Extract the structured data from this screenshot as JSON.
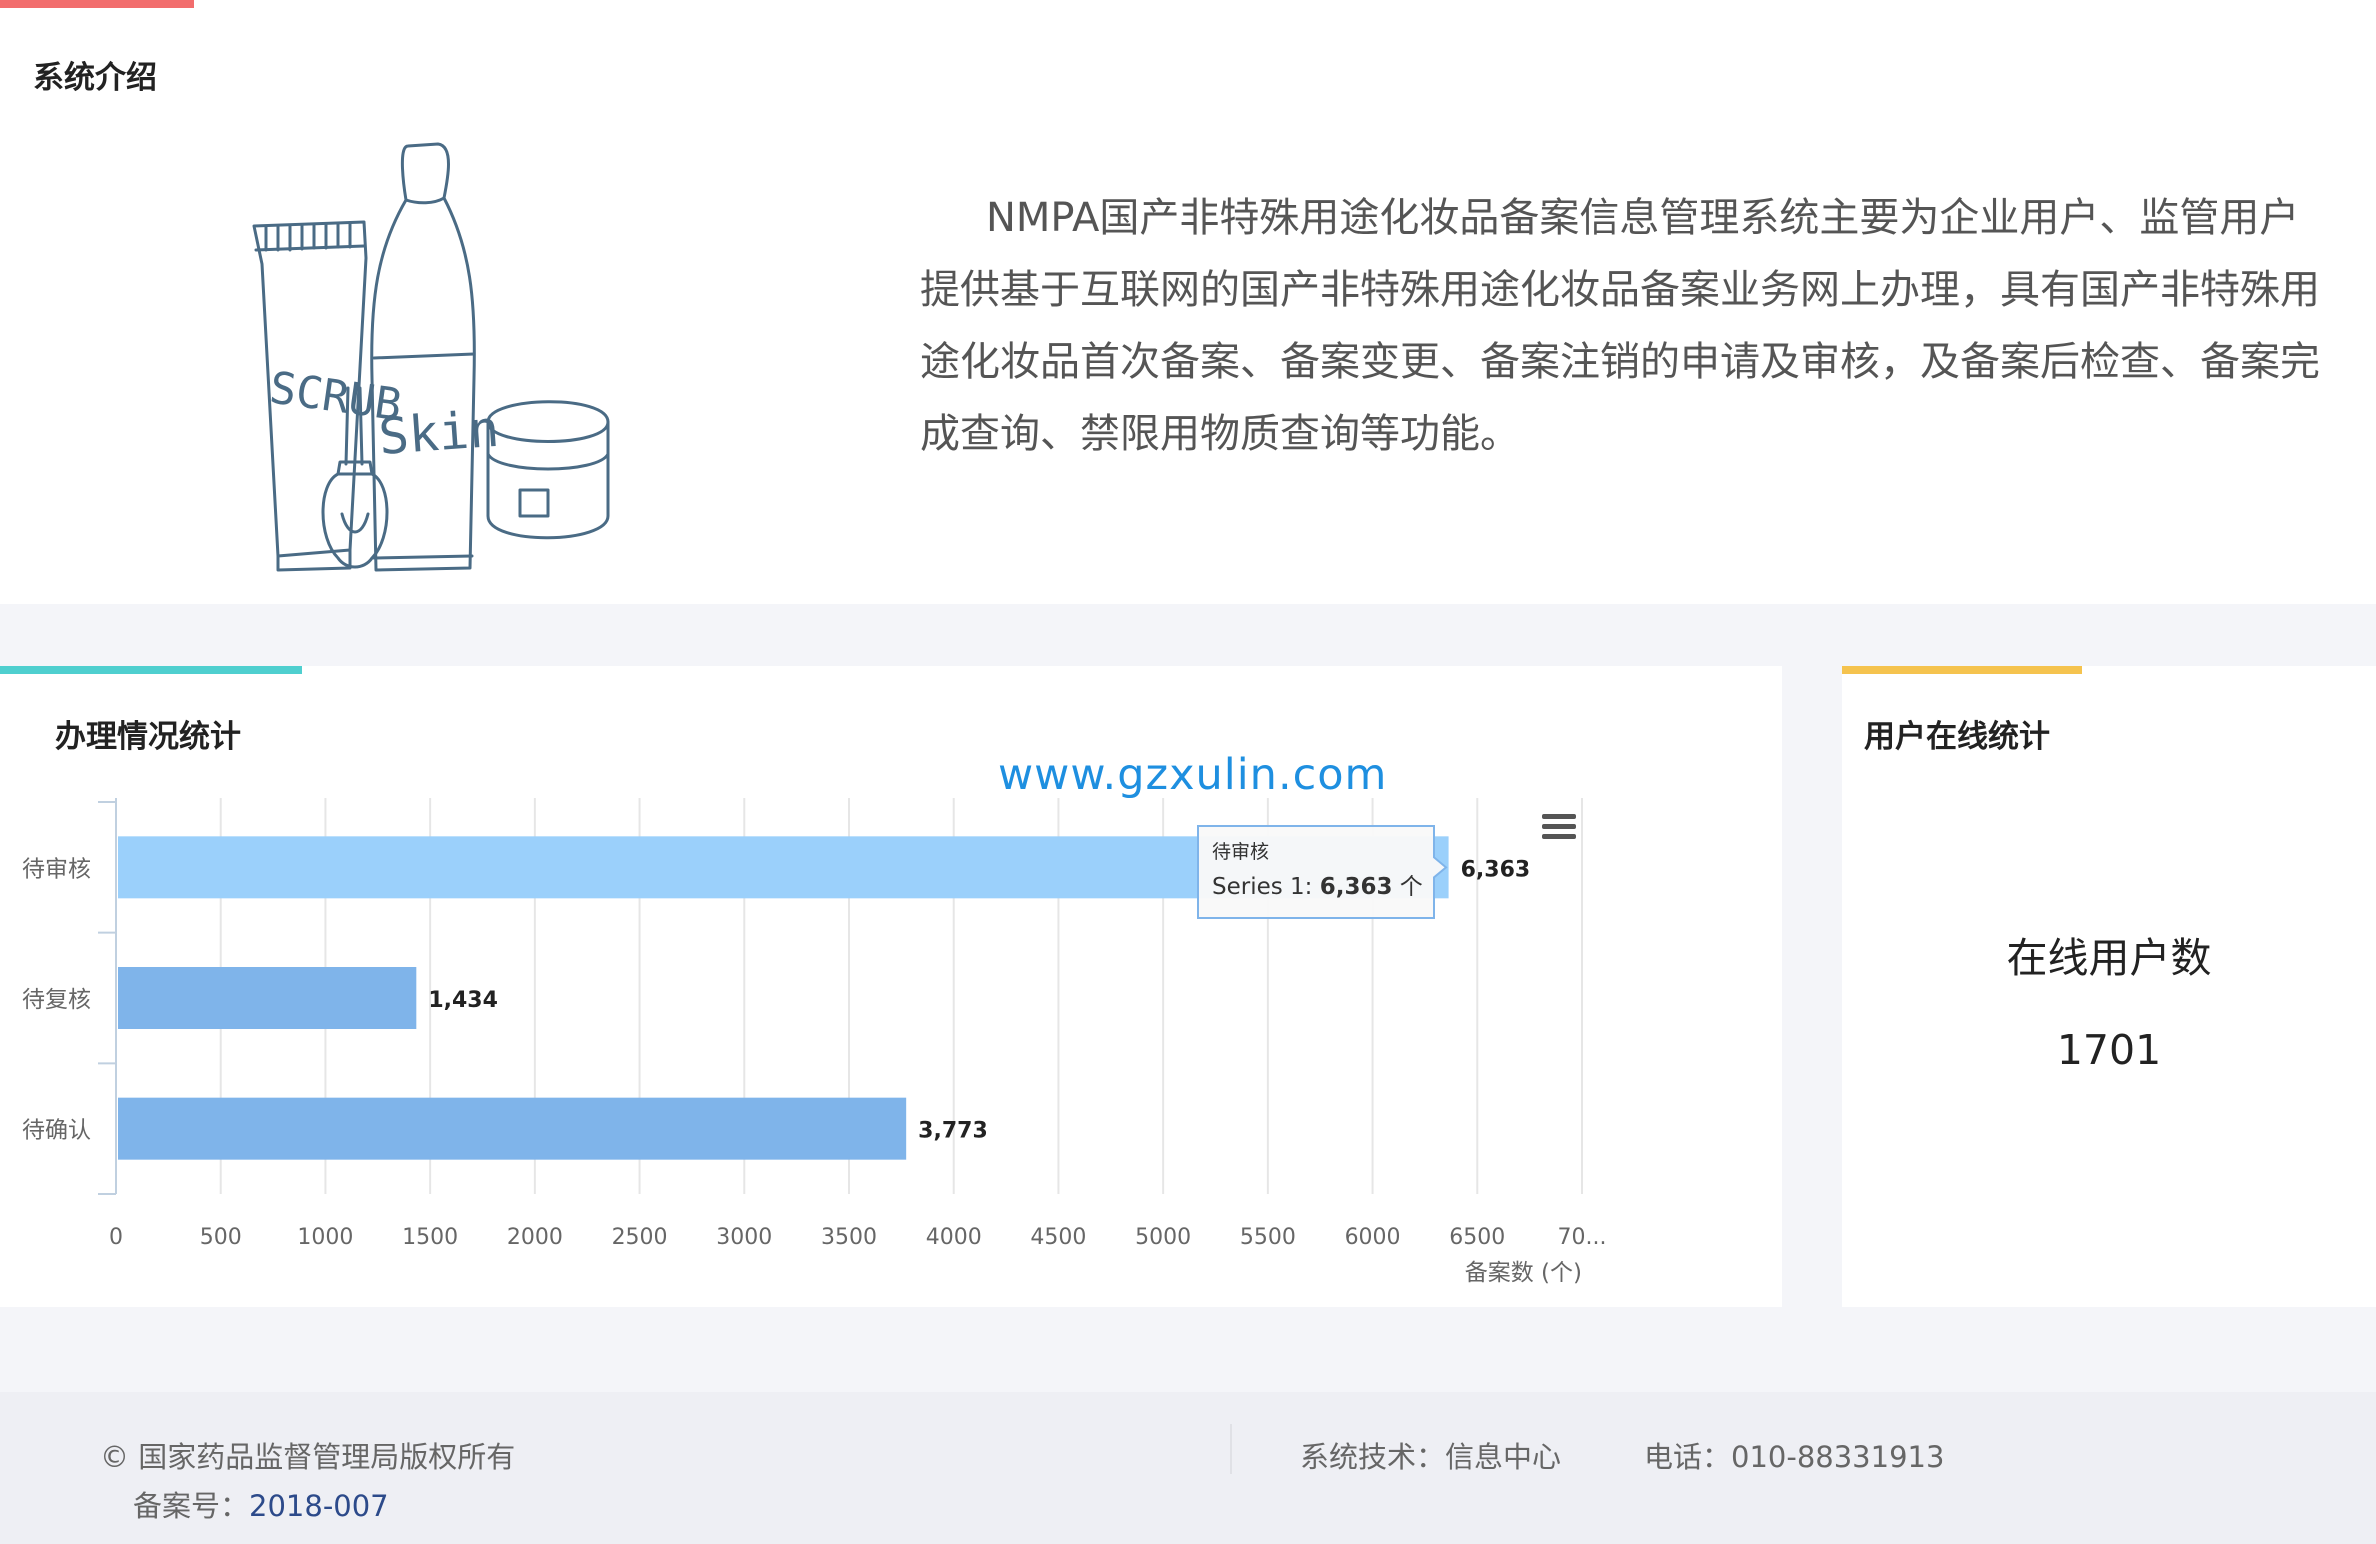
{
  "colors": {
    "intro_accent": "#f26d6d",
    "stats_accent": "#4fcfcf",
    "online_accent": "#f5c34e",
    "bar_highlight": "#9bd0fb",
    "bar": "#7fb4ea",
    "watermark": "#1e8fe0"
  },
  "intro": {
    "title": "系统介绍",
    "text": "NMPA国产非特殊用途化妆品备案信息管理系统主要为企业用户、监管用户提供基于互联网的国产非特殊用途化妆品备案业务网上办理，具有国产非特殊用途化妆品首次备案、备案变更、备案注销的申请及审核，及备案后检查、备案完成查询、禁限用物质查询等功能。",
    "illustration": {
      "tube_label": "SCRUB",
      "bottle_label": "Skin"
    }
  },
  "stats": {
    "title": "办理情况统计",
    "watermark": "www.gzxulin.com",
    "menu_icon": "hamburger-menu-icon"
  },
  "chart_data": {
    "type": "bar",
    "orientation": "horizontal",
    "categories": [
      "待审核",
      "待复核",
      "待确认"
    ],
    "series": [
      {
        "name": "Series 1",
        "values": [
          6363,
          1434,
          3773
        ]
      }
    ],
    "data_labels": [
      "6,363",
      "1,434",
      "3,773"
    ],
    "x_ticks": [
      "0",
      "500",
      "1000",
      "1500",
      "2000",
      "2500",
      "3000",
      "3500",
      "4000",
      "4500",
      "5000",
      "5500",
      "6000",
      "6500",
      "70..."
    ],
    "xlim": [
      0,
      7000
    ],
    "xlabel": "备案数 (个)",
    "grid": true,
    "highlighted_index": 0,
    "tooltip": {
      "category": "待审核",
      "series_prefix": "Series 1: ",
      "value": "6,363",
      "unit": " 个"
    }
  },
  "online": {
    "title": "用户在线统计",
    "label": "在线用户数",
    "count": "1701"
  },
  "footer": {
    "copyright": "© 国家药品监督管理局版权所有",
    "record_label": "备案号：",
    "record_number": "2018-007",
    "tech": "系统技术：信息中心",
    "phone": "电话：010-88331913"
  }
}
